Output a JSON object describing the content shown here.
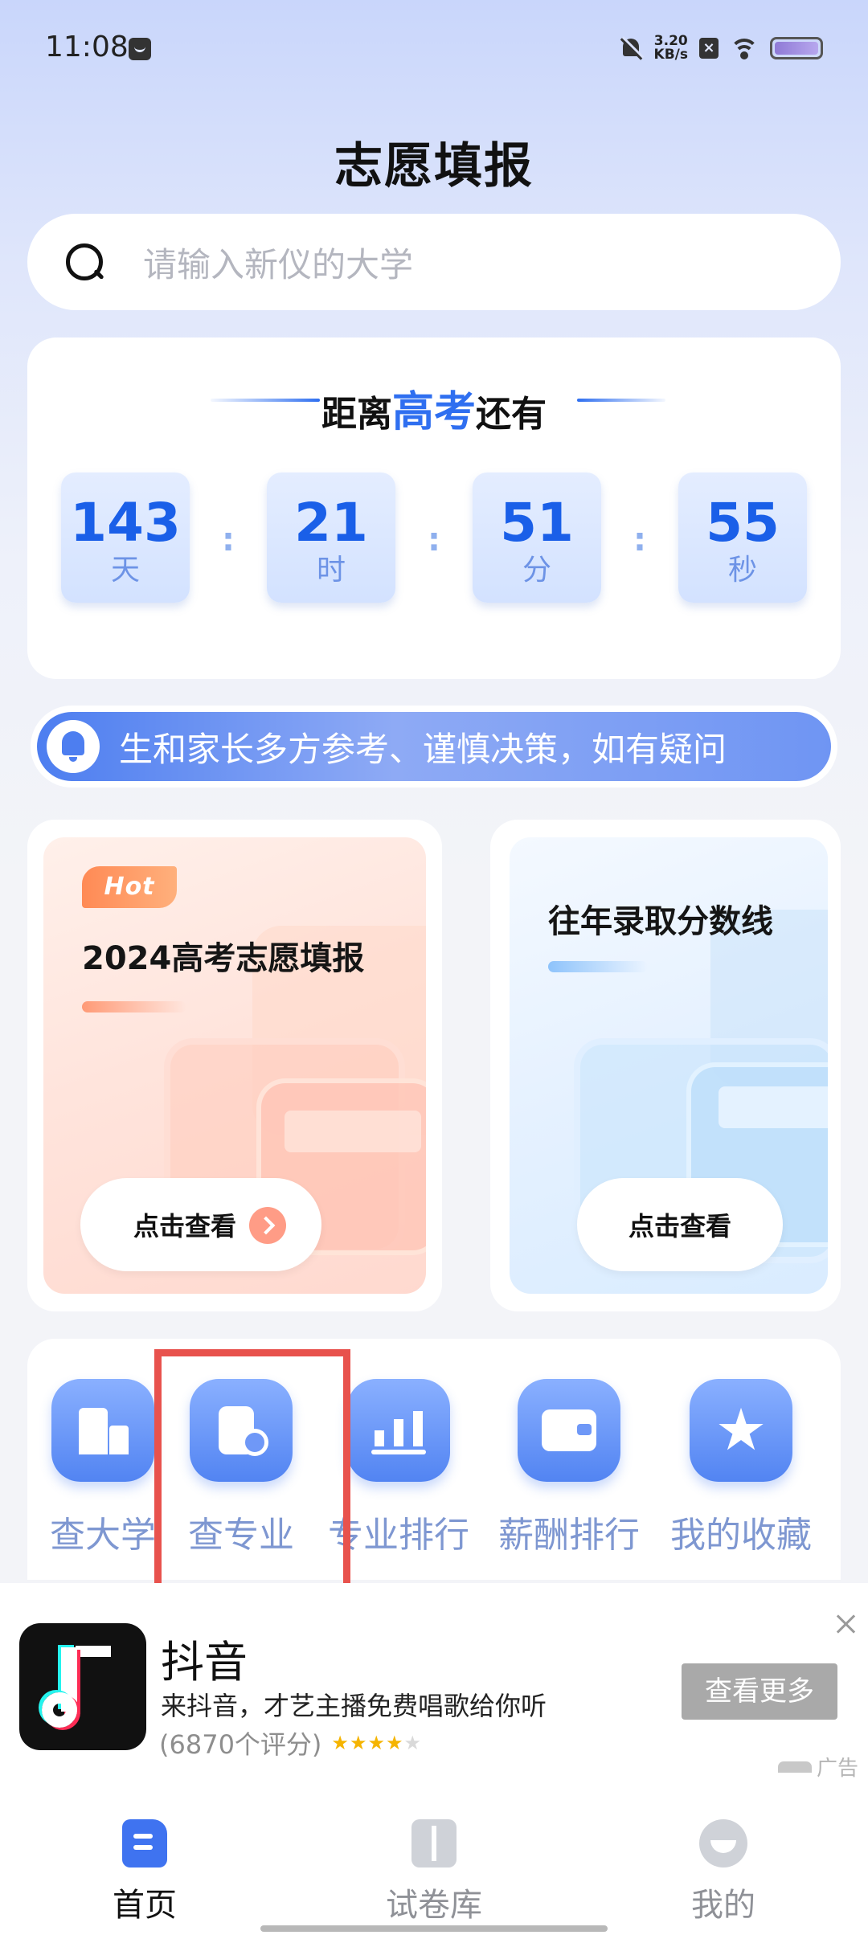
{
  "status_bar": {
    "time": "11:08",
    "net_speed_value": "3.20",
    "net_speed_unit": "KB/s",
    "icons": [
      "message-icon",
      "bell-off-icon",
      "sim-x-icon",
      "wifi-icon",
      "battery-icon"
    ]
  },
  "header": {
    "title": "志愿填报"
  },
  "search": {
    "placeholder": "请输入新仪的大学"
  },
  "countdown": {
    "title_prefix": "距离",
    "title_highlight": "高考",
    "title_suffix": "还有",
    "separator": ":",
    "units": [
      {
        "value": "143",
        "unit": "天"
      },
      {
        "value": "21",
        "unit": "时"
      },
      {
        "value": "51",
        "unit": "分"
      },
      {
        "value": "55",
        "unit": "秒"
      }
    ]
  },
  "notice": {
    "text": "生和家长多方参考、谨慎决策，如有疑问"
  },
  "promo_cards": {
    "left": {
      "badge": "Hot",
      "title": "2024高考志愿填报",
      "button": "点击查看"
    },
    "right": {
      "title": "往年录取分数线",
      "button": "点击查看"
    }
  },
  "quick_actions": [
    {
      "label": "查大学",
      "icon": "building-icon"
    },
    {
      "label": "查专业",
      "icon": "major-search-icon"
    },
    {
      "label": "专业排行",
      "icon": "bar-chart-icon"
    },
    {
      "label": "薪酬排行",
      "icon": "wallet-icon"
    },
    {
      "label": "我的收藏",
      "icon": "star-icon"
    }
  ],
  "ad": {
    "app_name": "抖音",
    "description": "来抖音，才艺主播免费唱歌给你听",
    "rating_text": "(6870个评分)",
    "rating_stars": 4,
    "cta": "查看更多",
    "label": "广告"
  },
  "bottom_nav": [
    {
      "label": "首页",
      "icon": "home-doc-icon",
      "active": true
    },
    {
      "label": "试卷库",
      "icon": "book-icon",
      "active": false
    },
    {
      "label": "我的",
      "icon": "profile-icon",
      "active": false
    }
  ],
  "colors": {
    "accent": "#2f6ff0",
    "highlight_box": "#e8524d",
    "action_label": "#7e97d1"
  }
}
